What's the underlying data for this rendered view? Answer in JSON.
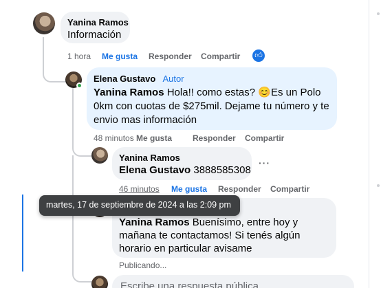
{
  "comments": [
    {
      "author": "Yanina Ramos",
      "text": "Información",
      "time": "1 hora",
      "like": "Me gusta",
      "reply": "Responder",
      "share": "Compartir",
      "reaction_icon": "like-reaction-icon"
    },
    {
      "author": "Elena Gustavo",
      "badge": "Autor",
      "mention": "Yanina Ramos",
      "text_line1": " Hola!! como estas? 😊Es un Polo",
      "text_line2": "0km con cuotas de $275mil. Dejame tu número y te",
      "text_line3": "envio mas información",
      "time": "48 minutos",
      "like": "Me gusta",
      "reply": "Responder",
      "share": "Compartir"
    },
    {
      "author": "Yanina Ramos",
      "mention": "Elena Gustavo",
      "text": " 3888585308",
      "time": "46 minutos",
      "like": "Me gusta",
      "reply": "Responder",
      "share": "Compartir",
      "more": "···"
    },
    {
      "mention": "Yanina Ramos",
      "text_line1": " Buenísimo, entre hoy y",
      "text_line2": "mañana te contactamos! Si tenés algún",
      "text_line3": "horario en particular avisame",
      "status": "Publicando..."
    }
  ],
  "tooltip": "martes, 17 de septiembre de 2024 a las 2:09 pm",
  "reply_input": {
    "placeholder": "Escribe una respuesta pública..."
  },
  "colors": {
    "accent": "#1b74e4",
    "bubble": "#f0f2f5",
    "author_bubble": "#e7f3ff",
    "tooltip_bg": "#3e4042"
  }
}
